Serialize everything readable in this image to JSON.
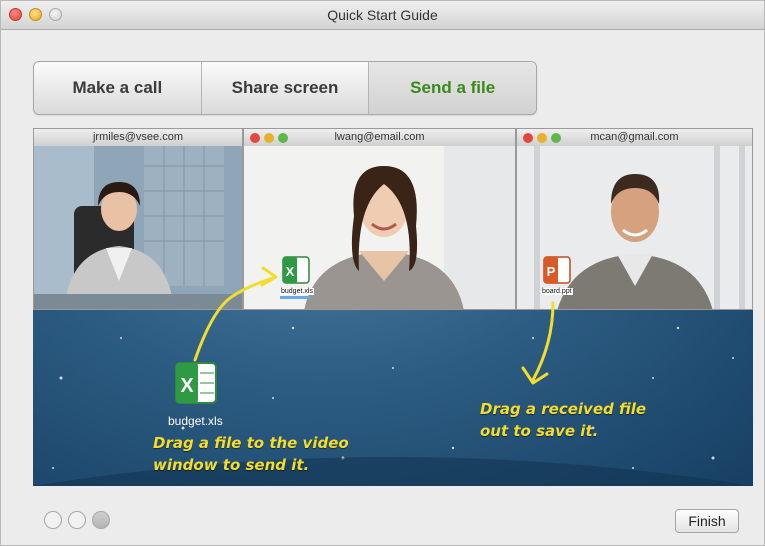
{
  "window": {
    "title": "Quick Start Guide"
  },
  "tabs": [
    {
      "label": "Make a call",
      "active": false
    },
    {
      "label": "Share screen",
      "active": false
    },
    {
      "label": "Send a file",
      "active": true
    }
  ],
  "panes": [
    {
      "email": "jrmiles@vsee.com"
    },
    {
      "email": "lwang@email.com"
    },
    {
      "email": "mcan@gmail.com"
    }
  ],
  "files": {
    "sent_small": "budget.xls",
    "received_small": "board.ppt",
    "desktop": "budget.xls"
  },
  "captions": {
    "send_line1": "Drag a file to the video",
    "send_line2": "window to send it.",
    "save_line1": "Drag a received file",
    "save_line2": "out to save it."
  },
  "pager": {
    "pages": 3,
    "current": 3
  },
  "buttons": {
    "finish": "Finish"
  },
  "colors": {
    "active_tab": "#3a8a1a",
    "caption": "#f3dd2c",
    "background": "#2d5d83"
  }
}
